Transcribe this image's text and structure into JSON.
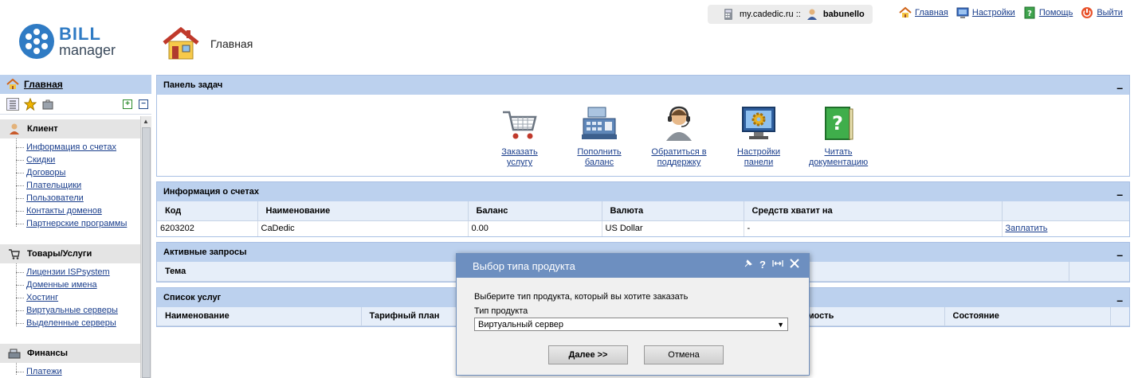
{
  "top": {
    "site": "my.cadedic.ru ::",
    "user": "babunello",
    "links": [
      {
        "label": "Главная",
        "icon": "home-icon"
      },
      {
        "label": "Настройки",
        "icon": "settings-icon"
      },
      {
        "label": "Помощь",
        "icon": "help-icon"
      },
      {
        "label": "Выйти",
        "icon": "power-icon"
      }
    ]
  },
  "logo": {
    "line1": "BILL",
    "line2": "manager"
  },
  "page": {
    "title": "Главная"
  },
  "sidebar": {
    "home": "Главная",
    "groups": [
      {
        "title": "Клиент",
        "items": [
          "Информация о счетах",
          "Скидки",
          "Договоры",
          "Плательщики",
          "Пользователи",
          "Контакты доменов",
          "Партнерские программы"
        ]
      },
      {
        "title": "Товары/Услуги",
        "items": [
          "Лицензии ISPsystem",
          "Доменные имена",
          "Хостинг",
          "Виртуальные серверы",
          "Выделенные серверы"
        ]
      },
      {
        "title": "Финансы",
        "items": [
          "Платежи"
        ]
      }
    ]
  },
  "tasks_panel": {
    "title": "Панель задач",
    "tasks": [
      {
        "line1": "Заказать",
        "line2": "услугу"
      },
      {
        "line1": "Пополнить",
        "line2": "баланс"
      },
      {
        "line1": "Обратиться в",
        "line2": "поддержку"
      },
      {
        "line1": "Настройки",
        "line2": "панели"
      },
      {
        "line1": "Читать",
        "line2": "документацию"
      }
    ]
  },
  "accounts_panel": {
    "title": "Информация о счетах",
    "columns": [
      "Код",
      "Наименование",
      "Баланс",
      "Валюта",
      "Средств хватит на",
      ""
    ],
    "row": [
      "6203202",
      "CaDedic",
      "0.00",
      "US Dollar",
      "-",
      "Заплатить"
    ]
  },
  "requests_panel": {
    "title": "Активные запросы",
    "columns": [
      "Тема"
    ]
  },
  "services_panel": {
    "title": "Список услуг",
    "columns": [
      "Наименование",
      "Тарифный план",
      "мость",
      "Состояние"
    ]
  },
  "modal": {
    "title": "Выбор типа продукта",
    "description": "Выберите тип продукта, который вы хотите заказать",
    "field_label": "Тип продукта",
    "selected": "Виртуальный сервер",
    "next": "Далее >>",
    "cancel": "Отмена"
  },
  "minimize": "–"
}
